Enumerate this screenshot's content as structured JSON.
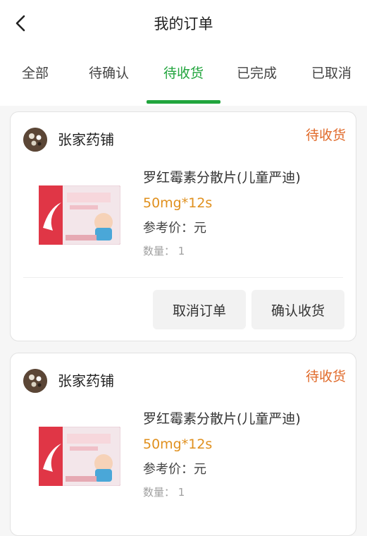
{
  "header": {
    "title": "我的订单",
    "back_icon": "chevron-left-icon"
  },
  "tabs": [
    {
      "label": "全部",
      "active": false
    },
    {
      "label": "待确认",
      "active": false
    },
    {
      "label": "待收货",
      "active": true
    },
    {
      "label": "已完成",
      "active": false
    },
    {
      "label": "已取消",
      "active": false
    }
  ],
  "colors": {
    "accent_green": "#20a43c",
    "status_orange": "#e06a2a",
    "spec_orange": "#e0901e"
  },
  "orders": [
    {
      "shop_name": "张家药铺",
      "status": "待收货",
      "product_name": "罗红霉素分散片(儿童严迪)",
      "spec": "50mg*12s",
      "price_label": "参考价：元",
      "qty_label": "数量：  1",
      "actions": {
        "cancel": "取消订单",
        "confirm": "确认收货"
      }
    },
    {
      "shop_name": "张家药铺",
      "status": "待收货",
      "product_name": "罗红霉素分散片(儿童严迪)",
      "spec": "50mg*12s",
      "price_label": "参考价：元",
      "qty_label": "数量：  1"
    }
  ]
}
